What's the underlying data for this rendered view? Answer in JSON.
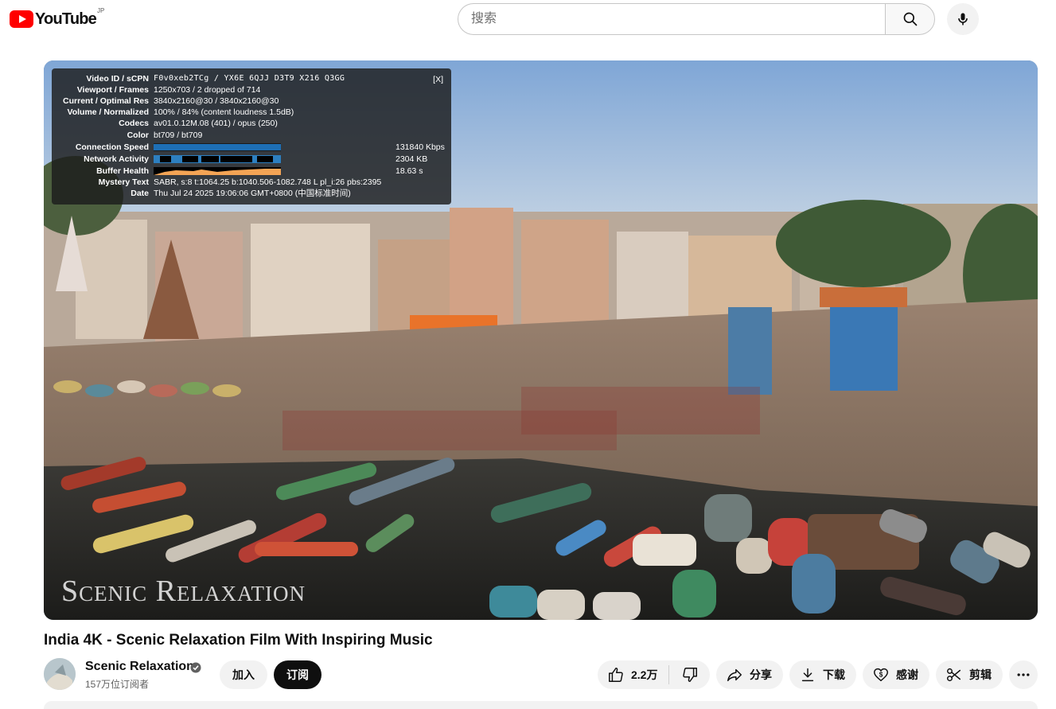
{
  "header": {
    "logo_text": "YouTube",
    "logo_region": "JP",
    "search_placeholder": "搜索",
    "search_icon": "search-icon",
    "mic_icon": "mic-icon"
  },
  "player": {
    "watermark": "Scenic Relaxation",
    "stats": {
      "close": "[X]",
      "rows": [
        {
          "label": "Video ID / sCPN",
          "value": "F0v0xeb2TCg / YX6E 6QJJ D3T9 X216 Q3GG"
        },
        {
          "label": "Viewport / Frames",
          "value": "1250x703 / 2 dropped of 714"
        },
        {
          "label": "Current / Optimal Res",
          "value": "3840x2160@30 / 3840x2160@30"
        },
        {
          "label": "Volume / Normalized",
          "value": "100% / 84% (content loudness 1.5dB)"
        },
        {
          "label": "Codecs",
          "value": "av01.0.12M.08 (401) / opus (250)"
        },
        {
          "label": "Color",
          "value": "bt709 / bt709"
        },
        {
          "label": "Connection Speed",
          "value": "131840 Kbps"
        },
        {
          "label": "Network Activity",
          "value": "2304 KB"
        },
        {
          "label": "Buffer Health",
          "value": "18.63 s"
        },
        {
          "label": "Mystery Text",
          "value": "SABR, s:8 t:1064.25 b:1040.506-1082.748 L pl_i:26 pbs:2395"
        },
        {
          "label": "Date",
          "value": "Thu Jul 24 2025 19:06:06 GMT+0800 (中国标准时间)"
        }
      ]
    }
  },
  "video": {
    "title": "India 4K - Scenic Relaxation Film With Inspiring Music",
    "channel_name": "Scenic Relaxation",
    "subscribers": "157万位订阅者",
    "join_label": "加入",
    "subscribe_label": "订阅"
  },
  "actions": {
    "like_count": "2.2万",
    "share_label": "分享",
    "download_label": "下载",
    "thanks_label": "感谢",
    "clip_label": "剪辑"
  },
  "colors": {
    "brand_red": "#ff0000",
    "chip_bg": "#f2f2f2",
    "text_primary": "#0f0f0f",
    "text_secondary": "#606060"
  }
}
